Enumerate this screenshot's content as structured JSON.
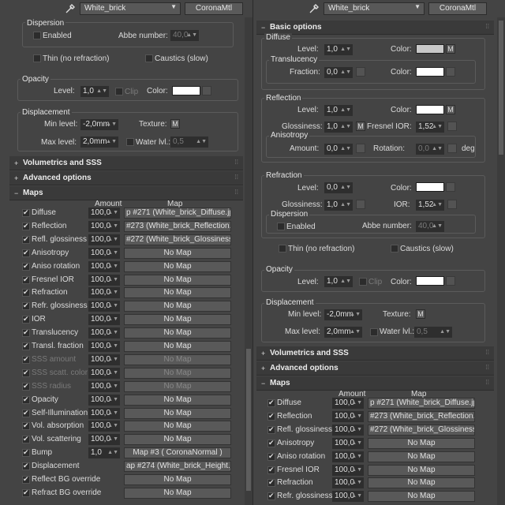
{
  "left": {
    "material_name": "White_brick",
    "material_type": "CoronaMtl",
    "dispersion": {
      "title": "Dispersion",
      "enabled_label": "Enabled",
      "enabled": false,
      "abbe_label": "Abbe number:",
      "abbe_value": "40,0"
    },
    "thin_label": "Thin (no refraction)",
    "caustics_label": "Caustics (slow)",
    "opacity": {
      "title": "Opacity",
      "level_label": "Level:",
      "level": "1,0",
      "clip_label": "Clip",
      "color_label": "Color:",
      "color": "#ffffff"
    },
    "displacement": {
      "title": "Displacement",
      "min_label": "Min level:",
      "min": "-2,0mm",
      "texture_label": "Texture:",
      "max_label": "Max level:",
      "max": "2,0mm",
      "water_label": "Water lvl.:",
      "water": "0,5",
      "m": "M"
    },
    "rollouts": {
      "volumetrics": "Volumetrics and SSS",
      "advanced": "Advanced options",
      "maps": "Maps"
    },
    "maps_header": {
      "amount": "Amount",
      "map": "Map"
    },
    "maps": [
      {
        "name": "Diffuse",
        "on": true,
        "amount": "100,0",
        "map": "p #271 (White_brick_Diffuse.jpe"
      },
      {
        "name": "Reflection",
        "on": true,
        "amount": "100,0",
        "map": "#273 (White_brick_Reflection.jp"
      },
      {
        "name": "Refl. glossiness",
        "on": true,
        "amount": "100,0",
        "map": "#272 (White_brick_Glossiness.jp"
      },
      {
        "name": "Anisotropy",
        "on": true,
        "amount": "100,0",
        "map": "No Map"
      },
      {
        "name": "Aniso rotation",
        "on": true,
        "amount": "100,0",
        "map": "No Map"
      },
      {
        "name": "Fresnel IOR",
        "on": true,
        "amount": "100,0",
        "map": "No Map"
      },
      {
        "name": "Refraction",
        "on": true,
        "amount": "100,0",
        "map": "No Map"
      },
      {
        "name": "Refr. glossiness",
        "on": true,
        "amount": "100,0",
        "map": "No Map"
      },
      {
        "name": "IOR",
        "on": true,
        "amount": "100,0",
        "map": "No Map"
      },
      {
        "name": "Translucency",
        "on": true,
        "amount": "100,0",
        "map": "No Map"
      },
      {
        "name": "Transl. fraction",
        "on": true,
        "amount": "100,0",
        "map": "No Map"
      },
      {
        "name": "SSS amount",
        "on": true,
        "amount": "100,0",
        "map": "No Map",
        "disabled": true
      },
      {
        "name": "SSS scatt. color",
        "on": true,
        "amount": "100,0",
        "map": "No Map",
        "disabled": true
      },
      {
        "name": "SSS radius",
        "on": true,
        "amount": "100,0",
        "map": "No Map",
        "disabled": true
      },
      {
        "name": "Opacity",
        "on": true,
        "amount": "100,0",
        "map": "No Map"
      },
      {
        "name": "Self-Illumination",
        "on": true,
        "amount": "100,0",
        "map": "No Map"
      },
      {
        "name": "Vol. absorption",
        "on": true,
        "amount": "100,0",
        "map": "No Map"
      },
      {
        "name": "Vol. scattering",
        "on": true,
        "amount": "100,0",
        "map": "No Map"
      },
      {
        "name": "Bump",
        "on": true,
        "amount": "1,0",
        "map": "Map #3  ( CoronaNormal )"
      },
      {
        "name": "Displacement",
        "on": true,
        "amount": "",
        "map": "ap #274 (White_brick_Height.jpe"
      },
      {
        "name": "Reflect BG override",
        "on": true,
        "amount": "",
        "map": "No Map"
      },
      {
        "name": "Refract BG override",
        "on": true,
        "amount": "",
        "map": "No Map"
      }
    ]
  },
  "right": {
    "material_name": "White_brick",
    "material_type": "CoronaMtl",
    "basic_options": "Basic options",
    "diffuse": {
      "title": "Diffuse",
      "level_label": "Level:",
      "level": "1,0",
      "color_label": "Color:",
      "color": "#c8c8c8",
      "m": "M"
    },
    "translucency": {
      "title": "Translucency",
      "fraction_label": "Fraction:",
      "fraction": "0,0",
      "color_label": "Color:",
      "color": "#ffffff"
    },
    "reflection": {
      "title": "Reflection",
      "level_label": "Level:",
      "level": "1,0",
      "color_label": "Color:",
      "color": "#ffffff",
      "m": "M",
      "gloss_label": "Glossiness:",
      "gloss": "1,0",
      "fresnel_label": "Fresnel IOR:",
      "fresnel": "1,52"
    },
    "anisotropy": {
      "title": "Anisotropy",
      "amount_label": "Amount:",
      "amount": "0,0",
      "rotation_label": "Rotation:",
      "rotation": "0,0",
      "deg": "deg"
    },
    "refraction": {
      "title": "Refraction",
      "level_label": "Level:",
      "level": "0,0",
      "color_label": "Color:",
      "color": "#ffffff",
      "gloss_label": "Glossiness:",
      "gloss": "1,0",
      "ior_label": "IOR:",
      "ior": "1,52"
    },
    "dispersion": {
      "title": "Dispersion",
      "enabled_label": "Enabled",
      "abbe_label": "Abbe number:",
      "abbe_value": "40,0"
    },
    "thin_label": "Thin (no refraction)",
    "caustics_label": "Caustics (slow)",
    "opacity": {
      "title": "Opacity",
      "level_label": "Level:",
      "level": "1,0",
      "clip_label": "Clip",
      "color_label": "Color:",
      "color": "#ffffff"
    },
    "displacement": {
      "title": "Displacement",
      "min_label": "Min level:",
      "min": "-2,0mm",
      "texture_label": "Texture:",
      "max_label": "Max level:",
      "max": "2,0mm",
      "water_label": "Water lvl.:",
      "water": "0,5",
      "m": "M"
    },
    "rollouts": {
      "volumetrics": "Volumetrics and SSS",
      "advanced": "Advanced options",
      "maps": "Maps"
    },
    "maps_header": {
      "amount": "Amount",
      "map": "Map"
    },
    "maps": [
      {
        "name": "Diffuse",
        "on": true,
        "amount": "100,0",
        "map": "p #271 (White_brick_Diffuse.jpe"
      },
      {
        "name": "Reflection",
        "on": true,
        "amount": "100,0",
        "map": "#273 (White_brick_Reflection.jp"
      },
      {
        "name": "Refl. glossiness",
        "on": true,
        "amount": "100,0",
        "map": "#272 (White_brick_Glossiness.jp"
      },
      {
        "name": "Anisotropy",
        "on": true,
        "amount": "100,0",
        "map": "No Map"
      },
      {
        "name": "Aniso rotation",
        "on": true,
        "amount": "100,0",
        "map": "No Map"
      },
      {
        "name": "Fresnel IOR",
        "on": true,
        "amount": "100,0",
        "map": "No Map"
      },
      {
        "name": "Refraction",
        "on": true,
        "amount": "100,0",
        "map": "No Map"
      },
      {
        "name": "Refr. glossiness",
        "on": true,
        "amount": "100,0",
        "map": "No Map"
      }
    ]
  }
}
